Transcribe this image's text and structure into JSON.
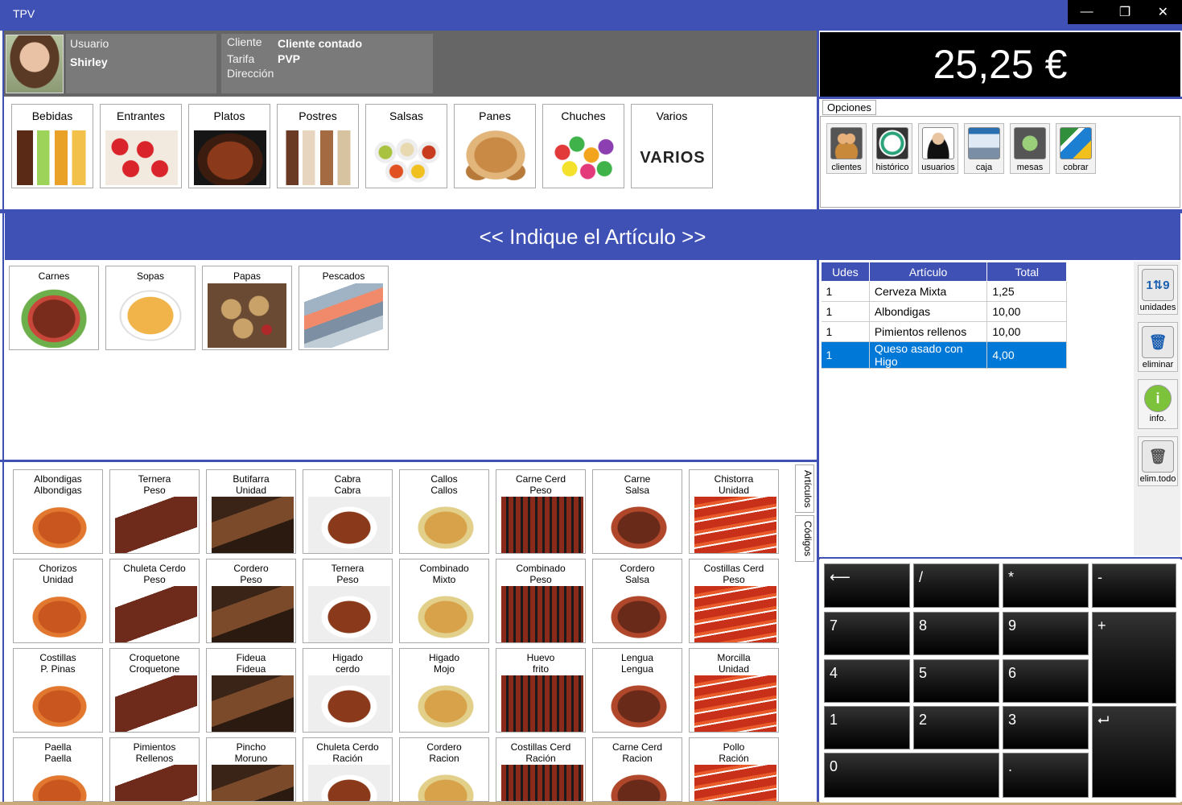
{
  "window": {
    "title": "TPV",
    "controls": [
      "minimize",
      "maximize",
      "close"
    ]
  },
  "header": {
    "user_label": "Usuario",
    "user_name": "Shirley",
    "client_label": "Cliente",
    "client_value": "Cliente contado",
    "tarifa_label": "Tarifa",
    "tarifa_value": "PVP",
    "direccion_label": "Dirección"
  },
  "total": "25,25 €",
  "categories": [
    "Bebidas",
    "Entrantes",
    "Platos",
    "Postres",
    "Salsas",
    "Panes",
    "Chuches",
    "Varios"
  ],
  "varios_text": "VARIOS",
  "options": {
    "tab_label": "Opciones",
    "items": [
      "clientes",
      "histórico",
      "usuarios",
      "caja",
      "mesas",
      "cobrar"
    ]
  },
  "prompt": "<< Indique el Artículo >>",
  "subcategories": [
    "Carnes",
    "Sopas",
    "Papas",
    "Pescados"
  ],
  "articles": [
    {
      "l1": "Albondigas",
      "l2": "Albondigas"
    },
    {
      "l1": "Ternera",
      "l2": "Peso"
    },
    {
      "l1": "Butifarra",
      "l2": "Unidad"
    },
    {
      "l1": "Cabra",
      "l2": "Cabra"
    },
    {
      "l1": "Callos",
      "l2": "Callos"
    },
    {
      "l1": "Carne Cerd",
      "l2": "Peso"
    },
    {
      "l1": "Carne",
      "l2": "Salsa"
    },
    {
      "l1": "Chistorra",
      "l2": "Unidad"
    },
    {
      "l1": "Chorizos",
      "l2": "Unidad"
    },
    {
      "l1": "Chuleta Cerdo",
      "l2": "Peso"
    },
    {
      "l1": "Cordero",
      "l2": "Peso"
    },
    {
      "l1": "Ternera",
      "l2": "Peso"
    },
    {
      "l1": "Combinado",
      "l2": "Mixto"
    },
    {
      "l1": "Combinado",
      "l2": "Peso"
    },
    {
      "l1": "Cordero",
      "l2": "Salsa"
    },
    {
      "l1": "Costillas Cerd",
      "l2": "Peso"
    },
    {
      "l1": "Costillas",
      "l2": "P. Pinas"
    },
    {
      "l1": "Croquetone",
      "l2": "Croquetone"
    },
    {
      "l1": "Fideua",
      "l2": "Fideua"
    },
    {
      "l1": "Higado",
      "l2": "cerdo"
    },
    {
      "l1": "Higado",
      "l2": "Mojo"
    },
    {
      "l1": "Huevo",
      "l2": "frito"
    },
    {
      "l1": "Lengua",
      "l2": "Lengua"
    },
    {
      "l1": "Morcilla",
      "l2": "Unidad"
    },
    {
      "l1": "Paella",
      "l2": "Paella"
    },
    {
      "l1": "Pimientos",
      "l2": "Rellenos"
    },
    {
      "l1": "Pincho",
      "l2": "Moruno"
    },
    {
      "l1": "Chuleta Cerdo",
      "l2": "Ración"
    },
    {
      "l1": "Cordero",
      "l2": "Racion"
    },
    {
      "l1": "Costillas Cerd",
      "l2": "Ración"
    },
    {
      "l1": "Carne Cerd",
      "l2": "Racion"
    },
    {
      "l1": "Pollo",
      "l2": "Ración"
    }
  ],
  "article_tabs": [
    "Artículos",
    "Códigos"
  ],
  "order": {
    "headers": [
      "Udes",
      "Artículo",
      "Total"
    ],
    "rows": [
      {
        "udes": "1",
        "articulo": "Cerveza Mixta",
        "total": "1,25"
      },
      {
        "udes": "1",
        "articulo": "Albondigas",
        "total": "10,00"
      },
      {
        "udes": "1",
        "articulo": "Pimientos rellenos",
        "total": "10,00"
      },
      {
        "udes": "1",
        "articulo": "Queso asado con Higo",
        "total": "4,00"
      }
    ],
    "selected_row": 3
  },
  "side_actions": [
    "unidades",
    "eliminar",
    "info.",
    "elim.todo"
  ],
  "keypad": [
    "⟵",
    "/",
    "*",
    "-",
    "7",
    "8",
    "9",
    "+",
    "4",
    "5",
    "6",
    "1",
    "2",
    "3",
    "⮠",
    "0",
    "."
  ],
  "colors": {
    "accent": "#3f51b5",
    "selection": "#0078d7"
  }
}
